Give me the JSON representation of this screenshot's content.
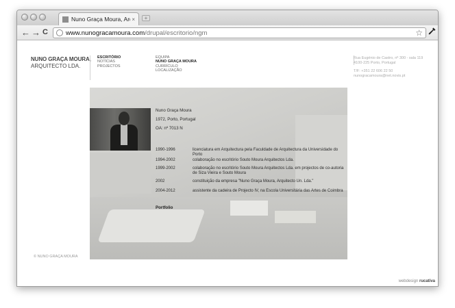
{
  "browser": {
    "tab_title": "Nuno Graça Moura, Arquitecto",
    "tab_close": "×",
    "newtab": "+",
    "back": "←",
    "forward": "→",
    "reload": "C",
    "url_domain": "www.nunogracamoura.com",
    "url_path": "/drupal/escritorio/ngm",
    "star": "☆",
    "wrench": "🔧"
  },
  "logo": {
    "line1": "NUNO GRAÇA MOURA,",
    "line2": "ARQUITECTO LDA."
  },
  "nav_main": [
    "ESCRITÓRIO",
    "NOTÍCIAS",
    "PROJECTOS"
  ],
  "nav_main_active": 0,
  "nav_sub": [
    "EQUIPA",
    "NUNO GRAÇA MOURA",
    "CURRÍCULO",
    "LOCALIZAÇÃO"
  ],
  "nav_sub_active": 1,
  "contact": {
    "addr1": "Rua Eugénio de Castro, nº 300 - sala 119",
    "addr2": "4100-225 Porto, Portugal",
    "tel": "T/F: +351 22 606 22 50",
    "email": "nunogracamoura@net.novis.pt"
  },
  "profile": {
    "name": "Nuno Graça Moura",
    "birth": "1972, Porto, Portugal",
    "oa": "OA: nº 7013 N"
  },
  "cv": [
    {
      "year": "1990-1996",
      "text": "licenciatura em Arquitectura pela Faculdade de Arquitectura da Universidade do Porto"
    },
    {
      "year": "1994-2002",
      "text": "colaboração no escritório Souto Moura Arquitectos Lda."
    },
    {
      "year": "1999-2002",
      "text": "colaboração no escritório Souto Moura Arquitectos Lda. em projectos de co-autoria de Siza Vieira e Souto Moura"
    },
    {
      "year": "2002",
      "text": "constituição da empresa \"Nuno Graça Moura, Arquitecto Un. Lda.\""
    },
    {
      "year": "2004-2012",
      "text": "assistente da cadeira de Projecto IV, na Escola Universitária das Artes de Coimbra"
    }
  ],
  "portfolio_label": "Portfolio",
  "footer": {
    "copyright": "© NUNO GRAÇA MOURA",
    "credit_prefix": "webdesign",
    "credit_name": "rucativa"
  },
  "colors": {
    "text_dark": "#2a2a2a",
    "text_muted": "#aaaaaa",
    "photo_bg": "#cfcfcc"
  }
}
